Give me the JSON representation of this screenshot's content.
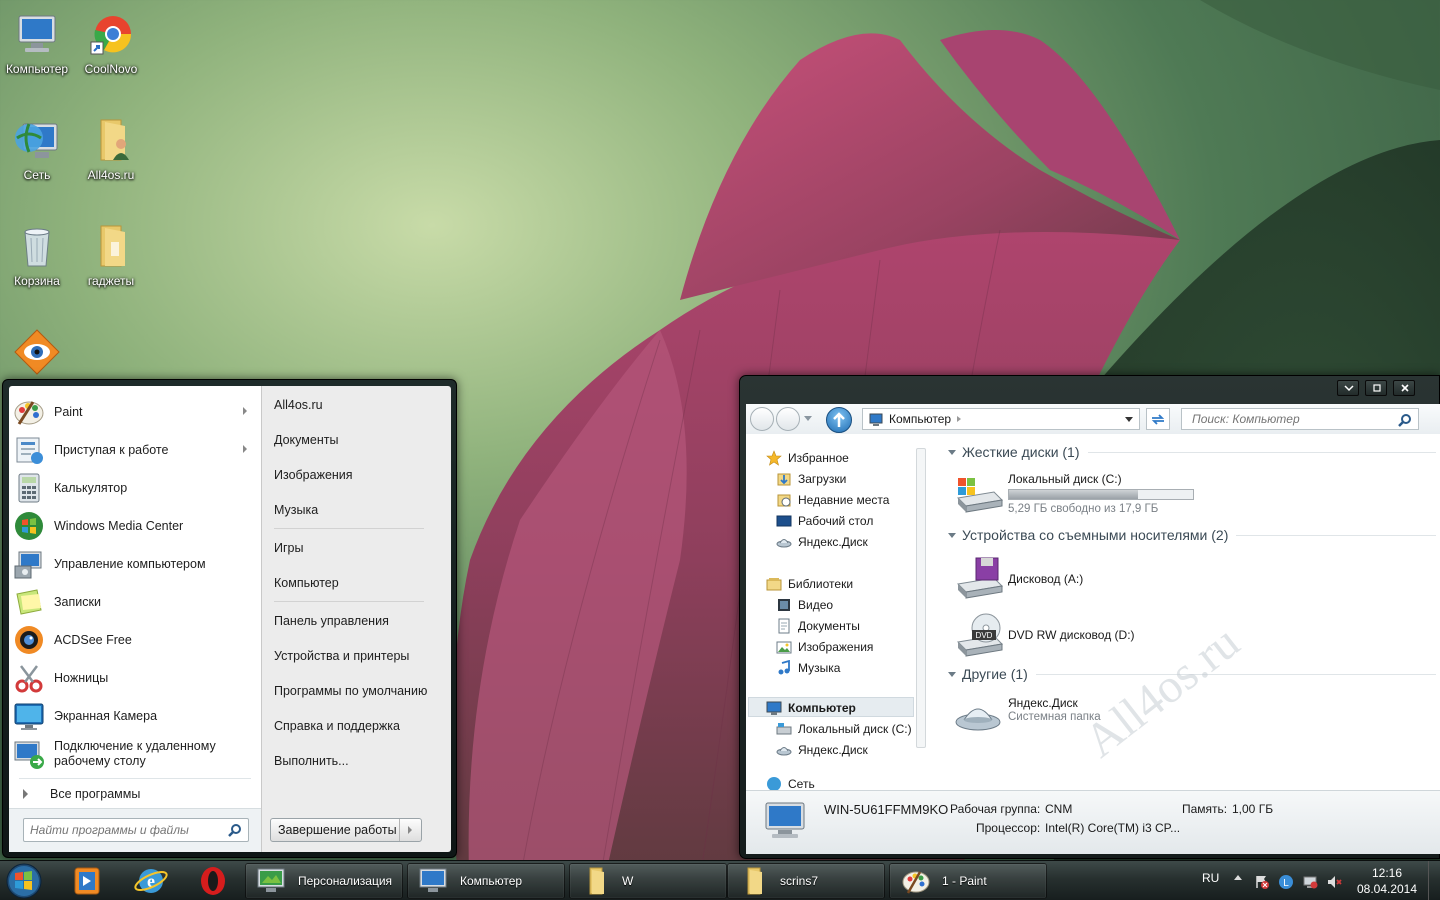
{
  "desktop": {
    "icons": [
      {
        "label": "Компьютер",
        "icon": "computer-icon"
      },
      {
        "label": "CoolNovo",
        "icon": "coolnovo-icon"
      },
      {
        "label": "Сеть",
        "icon": "network-icon"
      },
      {
        "label": "All4os.ru",
        "icon": "folder-user-icon"
      },
      {
        "label": "Корзина",
        "icon": "recycle-bin-icon"
      },
      {
        "label": "гаджеты",
        "icon": "folder-icon"
      },
      {
        "label": "",
        "icon": "acdsee-icon"
      }
    ]
  },
  "start_menu": {
    "programs": [
      {
        "label": "Paint",
        "has_submenu": true
      },
      {
        "label": "Приступая к работе",
        "has_submenu": true
      },
      {
        "label": "Калькулятор"
      },
      {
        "label": "Windows Media Center"
      },
      {
        "label": "Управление компьютером"
      },
      {
        "label": "Записки"
      },
      {
        "label": "ACDSee Free"
      },
      {
        "label": "Ножницы"
      },
      {
        "label": "Экранная Камера"
      },
      {
        "label": "Подключение к удаленному рабочему столу"
      }
    ],
    "all_programs": "Все программы",
    "search_placeholder": "Найти программы и файлы",
    "right_links": [
      "All4os.ru",
      "Документы",
      "Изображения",
      "Музыка",
      "Игры",
      "Компьютер",
      "Панель управления",
      "Устройства и принтеры",
      "Программы по умолчанию",
      "Справка и поддержка",
      "Выполнить..."
    ],
    "shutdown_label": "Завершение работы"
  },
  "explorer": {
    "address": "Компьютер",
    "search_placeholder": "Поиск: Компьютер",
    "nav": {
      "favorites": "Избранное",
      "favorites_items": [
        "Загрузки",
        "Недавние места",
        "Рабочий стол",
        "Яндекс.Диск"
      ],
      "libraries": "Библиотеки",
      "libraries_items": [
        "Видео",
        "Документы",
        "Изображения",
        "Музыка"
      ],
      "computer": "Компьютер",
      "computer_items": [
        "Локальный диск (C:)",
        "Яндекс.Диск"
      ],
      "network": "Сеть"
    },
    "groups": {
      "hdd": "Жесткие диски (1)",
      "removable": "Устройства со съемными носителями (2)",
      "other": "Другие (1)"
    },
    "drive_c": {
      "name": "Локальный диск (C:)",
      "free": "5,29 ГБ свободно из 17,9 ГБ",
      "used_fraction": 0.7
    },
    "drive_a": {
      "name": "Дисковод (A:)"
    },
    "drive_d": {
      "name": "DVD RW дисковод (D:)",
      "badge": "DVD"
    },
    "yandex": {
      "name": "Яндекс.Диск",
      "type": "Системная папка"
    },
    "watermark": "All4os.ru",
    "status": {
      "pc_name": "WIN-5U61FFMM9KO",
      "workgroup_label": "Рабочая группа:",
      "workgroup": "CNM",
      "memory_label": "Память:",
      "memory": "1,00 ГБ",
      "cpu_label": "Процессор:",
      "cpu": "Intel(R) Core(TM) i3 CP..."
    }
  },
  "taskbar": {
    "tasks": [
      {
        "label": "Персонализация"
      },
      {
        "label": "Компьютер"
      },
      {
        "label": "W"
      },
      {
        "label": "scrins7"
      },
      {
        "label": "1 - Paint"
      }
    ],
    "lang": "RU",
    "time": "12:16",
    "date": "08.04.2014"
  }
}
